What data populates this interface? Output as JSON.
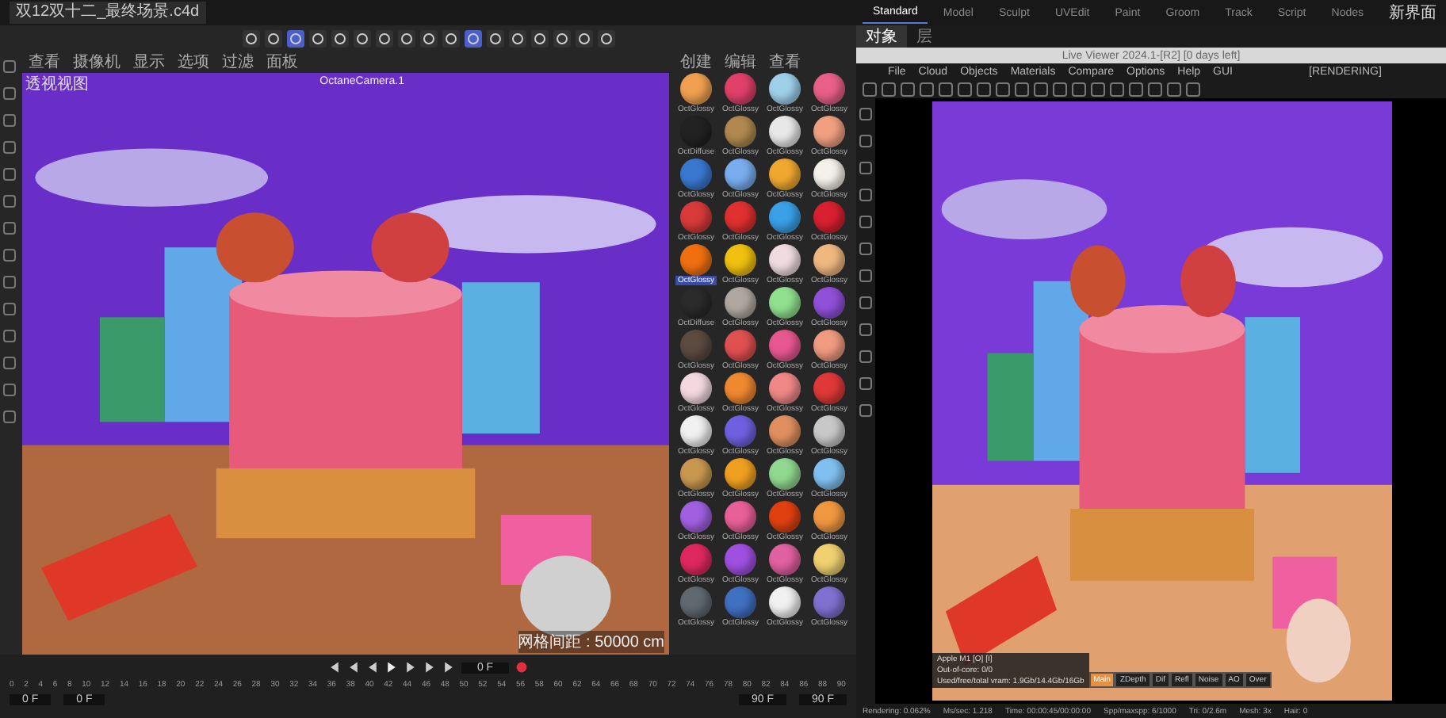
{
  "file_tab": "双12双十二_最终场景.c4d",
  "workspaces": [
    {
      "label": "Standard",
      "selected": true
    },
    {
      "label": "Model",
      "selected": false
    },
    {
      "label": "Sculpt",
      "selected": false
    },
    {
      "label": "UVEdit",
      "selected": false
    },
    {
      "label": "Paint",
      "selected": false
    },
    {
      "label": "Groom",
      "selected": false
    },
    {
      "label": "Track",
      "selected": false
    },
    {
      "label": "Script",
      "selected": false
    },
    {
      "label": "Nodes",
      "selected": false
    }
  ],
  "layout_label": "新界面",
  "main_toolbar": {
    "tools": [
      {
        "selected": false
      },
      {
        "selected": false
      },
      {
        "selected": true
      },
      {
        "selected": false
      },
      {
        "selected": false
      },
      {
        "selected": false
      },
      {
        "selected": false
      },
      {
        "selected": false
      },
      {
        "selected": false
      },
      {
        "selected": false
      },
      {
        "selected": true
      },
      {
        "selected": false
      },
      {
        "selected": false
      },
      {
        "selected": false
      },
      {
        "selected": false
      },
      {
        "selected": false
      },
      {
        "selected": false
      }
    ]
  },
  "viewport": {
    "title": "透视视图",
    "menu": [
      "查看",
      "摄像机",
      "显示",
      "选项",
      "过滤",
      "面板"
    ],
    "camera": "OctaneCamera.1",
    "grid_label": "网格间距 : 50000 cm"
  },
  "material_manager": {
    "menu": [
      "创建",
      "编辑",
      "查看"
    ],
    "materials": [
      {
        "label": "OctGlossy",
        "color": "#f0a050",
        "selected": false
      },
      {
        "label": "OctGlossy",
        "color": "#e0406a",
        "selected": false
      },
      {
        "label": "OctGlossy",
        "color": "#9fd0ea",
        "selected": false
      },
      {
        "label": "OctGlossy",
        "color": "#e8608a",
        "selected": false
      },
      {
        "label": "OctDiffuse",
        "color": "#222222",
        "selected": false
      },
      {
        "label": "OctGlossy",
        "color": "#b08850",
        "selected": false
      },
      {
        "label": "OctGlossy",
        "color": "#e8e8e8",
        "selected": false
      },
      {
        "label": "OctGlossy",
        "color": "#f0a080",
        "selected": false
      },
      {
        "label": "OctGlossy",
        "color": "#3a78d0",
        "selected": false
      },
      {
        "label": "OctGlossy",
        "color": "#78aef0",
        "selected": false
      },
      {
        "label": "OctGlossy",
        "color": "#f0a830",
        "selected": false
      },
      {
        "label": "OctGlossy",
        "color": "#f4f0ea",
        "selected": false
      },
      {
        "label": "OctGlossy",
        "color": "#d83a3a",
        "selected": false
      },
      {
        "label": "OctGlossy",
        "color": "#e03030",
        "selected": false
      },
      {
        "label": "OctGlossy",
        "color": "#3aa0e8",
        "selected": false
      },
      {
        "label": "OctGlossy",
        "color": "#d82030",
        "selected": false
      },
      {
        "label": "OctGlossy",
        "color": "#f07010",
        "selected": true
      },
      {
        "label": "OctGlossy",
        "color": "#f0c010",
        "selected": false
      },
      {
        "label": "OctGlossy",
        "color": "#f0dce0",
        "selected": false
      },
      {
        "label": "OctGlossy",
        "color": "#f0b880",
        "selected": false
      },
      {
        "label": "OctDiffuse",
        "color": "#2a2a2a",
        "selected": false
      },
      {
        "label": "OctGlossy",
        "color": "#b0a8a0",
        "selected": false
      },
      {
        "label": "OctGlossy",
        "color": "#90e090",
        "selected": false
      },
      {
        "label": "OctGlossy",
        "color": "#9050d8",
        "selected": false
      },
      {
        "label": "OctGlossy",
        "color": "#5a4a40",
        "selected": false
      },
      {
        "label": "OctGlossy",
        "color": "#e05050",
        "selected": false
      },
      {
        "label": "OctGlossy",
        "color": "#e85890",
        "selected": false
      },
      {
        "label": "OctGlossy",
        "color": "#f09a80",
        "selected": false
      },
      {
        "label": "OctGlossy",
        "color": "#f4d8e0",
        "selected": false
      },
      {
        "label": "OctGlossy",
        "color": "#f08830",
        "selected": false
      },
      {
        "label": "OctGlossy",
        "color": "#f08888",
        "selected": false
      },
      {
        "label": "OctGlossy",
        "color": "#e03838",
        "selected": false
      },
      {
        "label": "OctGlossy",
        "color": "#f0f0f0",
        "selected": false
      },
      {
        "label": "OctGlossy",
        "color": "#7060e0",
        "selected": false
      },
      {
        "label": "OctGlossy",
        "color": "#e09060",
        "selected": false
      },
      {
        "label": "OctGlossy",
        "color": "#c8c8c8",
        "selected": false
      },
      {
        "label": "OctGlossy",
        "color": "#c89850",
        "selected": false
      },
      {
        "label": "OctGlossy",
        "color": "#f0a020",
        "selected": false
      },
      {
        "label": "OctGlossy",
        "color": "#90d890",
        "selected": false
      },
      {
        "label": "OctGlossy",
        "color": "#80c0f0",
        "selected": false
      },
      {
        "label": "OctGlossy",
        "color": "#a060e0",
        "selected": false
      },
      {
        "label": "OctGlossy",
        "color": "#e86098",
        "selected": false
      },
      {
        "label": "OctGlossy",
        "color": "#e04010",
        "selected": false
      },
      {
        "label": "OctGlossy",
        "color": "#f09840",
        "selected": false
      },
      {
        "label": "OctGlossy",
        "color": "#e02860",
        "selected": false
      },
      {
        "label": "OctGlossy",
        "color": "#a050e0",
        "selected": false
      },
      {
        "label": "OctGlossy",
        "color": "#e060a0",
        "selected": false
      },
      {
        "label": "OctGlossy",
        "color": "#f0d070",
        "selected": false
      },
      {
        "label": "OctGlossy",
        "color": "#606870",
        "selected": false
      },
      {
        "label": "OctGlossy",
        "color": "#4070c0",
        "selected": false
      },
      {
        "label": "OctGlossy",
        "color": "#f0f0f0",
        "selected": false
      },
      {
        "label": "OctGlossy",
        "color": "#8070d0",
        "selected": false
      }
    ]
  },
  "timeline": {
    "current_frame": "0 F",
    "ticks": [
      "0",
      "2",
      "4",
      "6",
      "8",
      "10",
      "12",
      "14",
      "16",
      "18",
      "20",
      "22",
      "24",
      "26",
      "28",
      "30",
      "32",
      "34",
      "36",
      "38",
      "40",
      "42",
      "44",
      "46",
      "48",
      "50",
      "52",
      "54",
      "56",
      "58",
      "60",
      "62",
      "64",
      "66",
      "68",
      "70",
      "72",
      "74",
      "76",
      "78",
      "80",
      "82",
      "84",
      "86",
      "88",
      "90"
    ],
    "start": "0 F",
    "preview_start": "0 F",
    "preview_end": "90 F",
    "end": "90 F"
  },
  "live_viewer": {
    "tabs": [
      {
        "label": "对象",
        "selected": true
      },
      {
        "label": "层",
        "selected": false
      }
    ],
    "title": "Live Viewer 2024.1-[R2] [0 days left]",
    "menu": [
      "File",
      "Cloud",
      "Objects",
      "Materials",
      "Compare",
      "Options",
      "Help",
      "GUI"
    ],
    "status": "[RENDERING]",
    "info": [
      "Apple M1 [O] [I]",
      "Out-of-core: 0/0",
      "Used/free/total vram: 1.9Gb/14.4Gb/16Gb"
    ],
    "passes": [
      {
        "label": "Main",
        "selected": true
      },
      {
        "label": "ZDepth",
        "selected": false
      },
      {
        "label": "Dif",
        "selected": false
      },
      {
        "label": "Refl",
        "selected": false
      },
      {
        "label": "Noise",
        "selected": false
      },
      {
        "label": "AO",
        "selected": false
      },
      {
        "label": "Over",
        "selected": false
      }
    ],
    "stats": [
      "Rendering: 0.062%",
      "Ms/sec: 1.218",
      "Time: 00:00:45/00:00:00",
      "Spp/maxspp: 6/1000",
      "Tri: 0/2.6m",
      "Mesh: 3x",
      "Hair: 0"
    ]
  }
}
